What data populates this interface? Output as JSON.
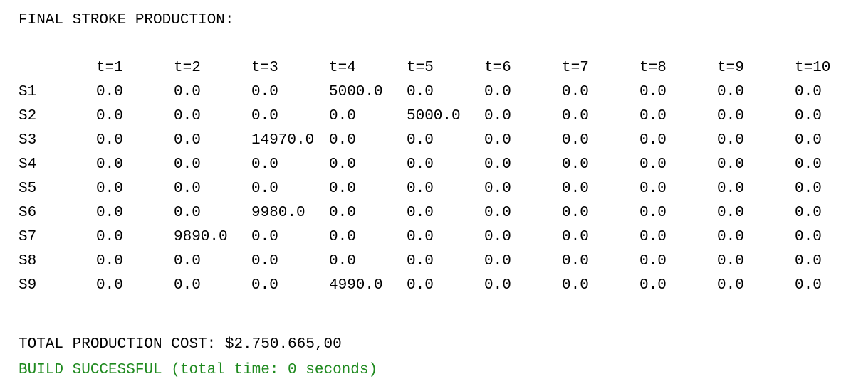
{
  "console": {
    "title": "FINAL STROKE PRODUCTION:",
    "table": {
      "headers": [
        "",
        "t=1",
        "t=2",
        "t=3",
        "t=4",
        "t=5",
        "t=6",
        "t=7",
        "t=8",
        "t=9",
        "t=10"
      ],
      "rows": [
        [
          "S1",
          "0.0",
          "0.0",
          "0.0",
          "5000.0",
          "0.0",
          "0.0",
          "0.0",
          "0.0",
          "0.0",
          "0.0"
        ],
        [
          "S2",
          "0.0",
          "0.0",
          "0.0",
          "0.0",
          "5000.0",
          "0.0",
          "0.0",
          "0.0",
          "0.0",
          "0.0"
        ],
        [
          "S3",
          "0.0",
          "0.0",
          "14970.0",
          "0.0",
          "0.0",
          "0.0",
          "0.0",
          "0.0",
          "0.0",
          "0.0"
        ],
        [
          "S4",
          "0.0",
          "0.0",
          "0.0",
          "0.0",
          "0.0",
          "0.0",
          "0.0",
          "0.0",
          "0.0",
          "0.0"
        ],
        [
          "S5",
          "0.0",
          "0.0",
          "0.0",
          "0.0",
          "0.0",
          "0.0",
          "0.0",
          "0.0",
          "0.0",
          "0.0"
        ],
        [
          "S6",
          "0.0",
          "0.0",
          "9980.0",
          "0.0",
          "0.0",
          "0.0",
          "0.0",
          "0.0",
          "0.0",
          "0.0"
        ],
        [
          "S7",
          "0.0",
          "9890.0",
          "0.0",
          "0.0",
          "0.0",
          "0.0",
          "0.0",
          "0.0",
          "0.0",
          "0.0"
        ],
        [
          "S8",
          "0.0",
          "0.0",
          "0.0",
          "0.0",
          "0.0",
          "0.0",
          "0.0",
          "0.0",
          "0.0",
          "0.0"
        ],
        [
          "S9",
          "0.0",
          "0.0",
          "0.0",
          "4990.0",
          "0.0",
          "0.0",
          "0.0",
          "0.0",
          "0.0",
          "0.0"
        ]
      ]
    },
    "total_cost": "TOTAL PRODUCTION COST: $2.750.665,00",
    "build_status": "BUILD SUCCESSFUL (total time: 0 seconds)",
    "colors": {
      "text": "#000000",
      "success": "#1f8a1f",
      "background": "#ffffff"
    }
  }
}
